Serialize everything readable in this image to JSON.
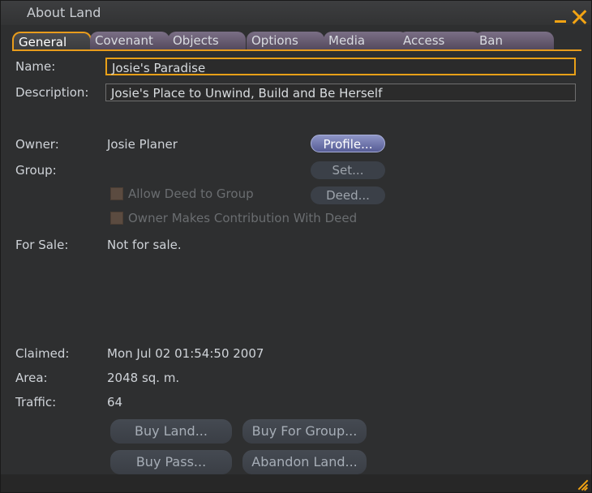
{
  "window": {
    "title": "About Land"
  },
  "tabs": [
    {
      "label": "General"
    },
    {
      "label": "Covenant"
    },
    {
      "label": "Objects"
    },
    {
      "label": "Options"
    },
    {
      "label": "Media"
    },
    {
      "label": "Access"
    },
    {
      "label": "Ban"
    }
  ],
  "general": {
    "name_label": "Name:",
    "name_value": "Josie's Paradise",
    "description_label": "Description:",
    "description_value": "Josie's Place to Unwind, Build and Be Herself",
    "owner_label": "Owner:",
    "owner_value": "Josie Planer",
    "profile_button": "Profile...",
    "group_label": "Group:",
    "set_button": "Set...",
    "deed_button": "Deed...",
    "allow_deed_label": "Allow Deed to Group",
    "owner_contrib_label": "Owner Makes Contribution With Deed",
    "for_sale_label": "For Sale:",
    "for_sale_value": "Not for sale.",
    "claimed_label": "Claimed:",
    "claimed_value": "Mon Jul 02 01:54:50 2007",
    "area_label": "Area:",
    "area_value": "2048 sq. m.",
    "traffic_label": "Traffic:",
    "traffic_value": "64",
    "buy_land_button": "Buy Land...",
    "buy_for_group_button": "Buy For Group...",
    "buy_pass_button": "Buy Pass...",
    "abandon_land_button": "Abandon Land..."
  },
  "colors": {
    "accent": "#f2a313",
    "primary_button": "#6b71ad"
  }
}
